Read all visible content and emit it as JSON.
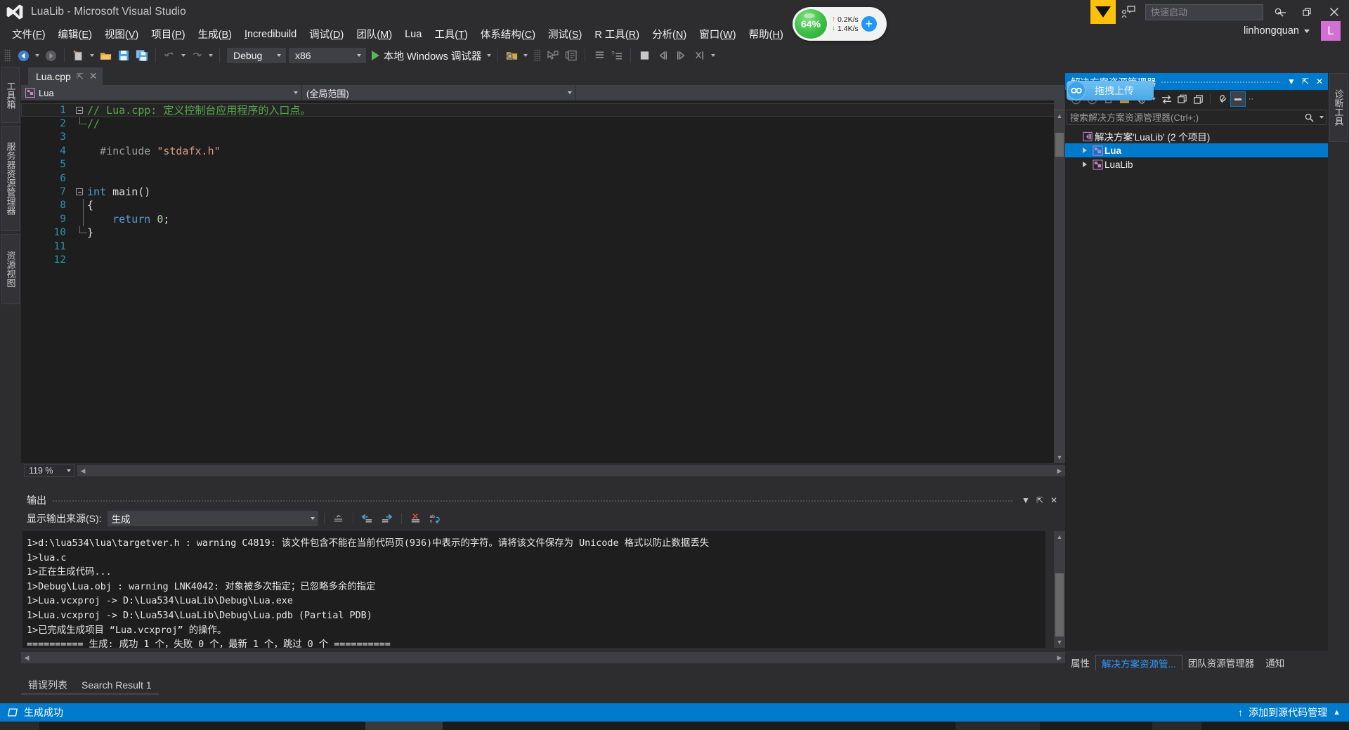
{
  "titlebar": {
    "title": "LuaLib - Microsoft Visual Studio",
    "quick_launch_placeholder": "快速启动",
    "minimize": "—",
    "restore": "❐",
    "close": "✕"
  },
  "menubar": {
    "items": [
      {
        "pre": "文件(",
        "key": "F",
        "post": ")"
      },
      {
        "pre": "编辑(",
        "key": "E",
        "post": ")"
      },
      {
        "pre": "视图(",
        "key": "V",
        "post": ")"
      },
      {
        "pre": "项目(",
        "key": "P",
        "post": ")"
      },
      {
        "pre": "生成(",
        "key": "B",
        "post": ")"
      },
      {
        "pre": "",
        "key": "I",
        "post": "ncredibuild"
      },
      {
        "pre": "调试(",
        "key": "D",
        "post": ")"
      },
      {
        "pre": "团队(",
        "key": "M",
        "post": ")"
      },
      {
        "pre": "Lua",
        "key": "",
        "post": ""
      },
      {
        "pre": "工具(",
        "key": "T",
        "post": ")"
      },
      {
        "pre": "体系结构(",
        "key": "C",
        "post": ")"
      },
      {
        "pre": "测试(",
        "key": "S",
        "post": ")"
      },
      {
        "pre": "R 工具(",
        "key": "R",
        "post": ")"
      },
      {
        "pre": "分析(",
        "key": "N",
        "post": ")"
      },
      {
        "pre": "窗口(",
        "key": "W",
        "post": ")"
      },
      {
        "pre": "帮助(",
        "key": "H",
        "post": ")"
      }
    ],
    "account_name": "linhongquan",
    "avatar_letter": "L"
  },
  "network_widget": {
    "percent": "64%",
    "upload": "0.2K/s",
    "download": "1.4K/s",
    "up_arrow": "↑",
    "down_arrow": "↓",
    "plus": "+"
  },
  "toolbar": {
    "config": "Debug",
    "platform": "x86",
    "run_label": "本地 Windows 调试器"
  },
  "left_dock": {
    "tabs": [
      "工具箱",
      "服务器资源管理器",
      "资源视图"
    ]
  },
  "editor": {
    "tab_name": "Lua.cpp",
    "pin_glyph": "⇱",
    "close_glyph": "✕",
    "nav_left": "Lua",
    "nav_middle": "(全局范围)",
    "nav_right": "",
    "zoom_level": "119 %",
    "lines": [
      {
        "n": "1",
        "marker": "fold-open",
        "segments": [
          {
            "cls": "c-comment",
            "t": "// Lua.cpp: 定义控制台应用程序的入口点。"
          }
        ],
        "highlight": true
      },
      {
        "n": "2",
        "marker": "fold-end",
        "segments": [
          {
            "cls": "c-comment",
            "t": "//"
          }
        ],
        "highlight": false
      },
      {
        "n": "3",
        "marker": "none",
        "segments": [],
        "highlight": false
      },
      {
        "n": "4",
        "marker": "none",
        "segments": [
          {
            "cls": "c-pp",
            "t": "  #include "
          },
          {
            "cls": "c-str",
            "t": "\"stdafx.h\""
          }
        ],
        "highlight": false
      },
      {
        "n": "5",
        "marker": "none",
        "segments": [],
        "highlight": false
      },
      {
        "n": "6",
        "marker": "none",
        "segments": [],
        "highlight": false
      },
      {
        "n": "7",
        "marker": "fold-open",
        "segments": [
          {
            "cls": "c-kw",
            "t": "int"
          },
          {
            "cls": "c-plain",
            "t": " main()"
          }
        ],
        "highlight": false
      },
      {
        "n": "8",
        "marker": "bar",
        "segments": [
          {
            "cls": "c-plain",
            "t": "{"
          }
        ],
        "highlight": false
      },
      {
        "n": "9",
        "marker": "bar",
        "segments": [
          {
            "cls": "c-kw",
            "t": "    return "
          },
          {
            "cls": "c-num",
            "t": "0"
          },
          {
            "cls": "c-plain",
            "t": ";"
          }
        ],
        "highlight": false
      },
      {
        "n": "10",
        "marker": "fold-end",
        "segments": [
          {
            "cls": "c-plain",
            "t": "}"
          }
        ],
        "highlight": false
      },
      {
        "n": "11",
        "marker": "none",
        "segments": [],
        "highlight": false
      },
      {
        "n": "12",
        "marker": "none",
        "segments": [],
        "highlight": false
      }
    ]
  },
  "solution_explorer": {
    "title": "解决方案资源管理器",
    "dropdown_glyph": "▼",
    "pin_glyph": "⇱",
    "close_glyph": "✕",
    "search_placeholder": "搜索解决方案资源管理器(Ctrl+;)",
    "upload_badge_text": "拖拽上传",
    "tree": [
      {
        "label": "解决方案'LuaLib' (2 个项目)",
        "indent": 0,
        "expander": false,
        "icon": "solution-icon",
        "selected": false,
        "bold": false
      },
      {
        "label": "Lua",
        "indent": 1,
        "expander": true,
        "icon": "project-cpp-icon",
        "selected": true,
        "bold": true
      },
      {
        "label": "LuaLib",
        "indent": 1,
        "expander": true,
        "icon": "project-cpp-icon",
        "selected": false,
        "bold": false
      }
    ],
    "bottom_tabs": [
      {
        "label": "属性",
        "active": false
      },
      {
        "label": "解决方案资源管...",
        "active": true
      },
      {
        "label": "团队资源管理器",
        "active": false
      },
      {
        "label": "通知",
        "active": false
      }
    ]
  },
  "right_dock": {
    "tabs": [
      "诊断工具"
    ]
  },
  "output": {
    "title": "输出",
    "source_label": "显示输出来源(S):",
    "source_value": "生成",
    "dropdown_glyph": "▼",
    "pin_glyph": "⇱",
    "close_glyph": "✕",
    "lines": [
      "1>d:\\lua534\\lua\\targetver.h : warning C4819: 该文件包含不能在当前代码页(936)中表示的字符。请将该文件保存为 Unicode 格式以防止数据丢失",
      "1>lua.c",
      "1>正在生成代码...",
      "1>Debug\\Lua.obj : warning LNK4042: 对象被多次指定；已忽略多余的指定",
      "1>Lua.vcxproj -> D:\\Lua534\\LuaLib\\Debug\\Lua.exe",
      "1>Lua.vcxproj -> D:\\Lua534\\LuaLib\\Debug\\Lua.pdb (Partial PDB)",
      "1>已完成生成项目 “Lua.vcxproj” 的操作。",
      "========== 生成: 成功 1 个，失败 0 个，最新 1 个，跳过 0 个 =========="
    ]
  },
  "bottom_tabs": [
    {
      "label": "错误列表"
    },
    {
      "label": "Search Result 1"
    }
  ],
  "statusbar": {
    "build_status": "生成成功",
    "source_control": "添加到源代码管理",
    "up_arrow": "↑",
    "caret": "▲"
  },
  "colors": {
    "accent": "#007acc",
    "titlebar_bg": "#2d2d30",
    "editor_bg": "#1e1e1e",
    "panel_bg": "#252526",
    "flag_yellow": "#fcc20b",
    "avatar": "#d470d4",
    "comment_green": "#57a64a",
    "string_orange": "#d69d85",
    "keyword_blue": "#569cd6",
    "linenum_blue": "#2b91af"
  }
}
